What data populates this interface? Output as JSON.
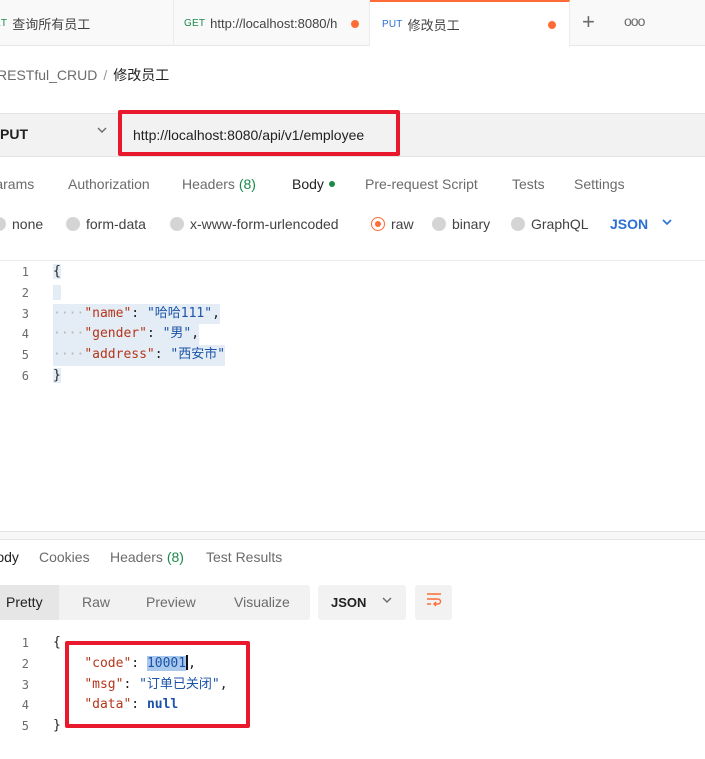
{
  "tabs": [
    {
      "method": "GET",
      "label": "查询所有员工",
      "dirty": false
    },
    {
      "method": "GET",
      "label": "http://localhost:8080/h",
      "dirty": true
    },
    {
      "method": "PUT",
      "label": "修改员工",
      "dirty": true
    }
  ],
  "tab_actions": {
    "plus": "+",
    "more": "ooo"
  },
  "breadcrumb": {
    "collection": "RESTful_CRUD",
    "separator": "/",
    "current": "修改员工"
  },
  "request": {
    "method": "PUT",
    "url": "http://localhost:8080/api/v1/employee",
    "tabs": [
      {
        "label": "Params"
      },
      {
        "label": "Authorization"
      },
      {
        "label": "Headers",
        "count": "(8)"
      },
      {
        "label": "Body",
        "active": true
      },
      {
        "label": "Pre-request Script"
      },
      {
        "label": "Tests"
      },
      {
        "label": "Settings"
      }
    ],
    "body_types": [
      {
        "label": "none"
      },
      {
        "label": "form-data"
      },
      {
        "label": "x-www-form-urlencoded"
      },
      {
        "label": "raw",
        "selected": true
      },
      {
        "label": "binary"
      },
      {
        "label": "GraphQL"
      }
    ],
    "body_format": "JSON",
    "body_lines": [
      "{",
      "\"name\": \"哈哈111\",",
      "\"gender\": \"男\",",
      "\"address\": \"西安市\"",
      "}"
    ],
    "body": {
      "name_key": "\"name\"",
      "name_val": "\"哈哈111\"",
      "gender_key": "\"gender\"",
      "gender_val": "\"男\"",
      "address_key": "\"address\"",
      "address_val": "\"西安市\""
    }
  },
  "response": {
    "tabs": [
      {
        "label": "Body",
        "active": true
      },
      {
        "label": "Cookies"
      },
      {
        "label": "Headers",
        "count": "(8)"
      },
      {
        "label": "Test Results"
      }
    ],
    "views": [
      "Pretty",
      "Raw",
      "Preview",
      "Visualize"
    ],
    "active_view": "Pretty",
    "format": "JSON",
    "body": {
      "code_key": "\"code\"",
      "code_val": "10001",
      "msg_key": "\"msg\"",
      "msg_val": "\"订单已关闭\"",
      "data_key": "\"data\"",
      "data_val": "null"
    }
  },
  "colors": {
    "accent": "#ff6c37",
    "highlight": "#e8192c",
    "link": "#2b6fd6"
  }
}
